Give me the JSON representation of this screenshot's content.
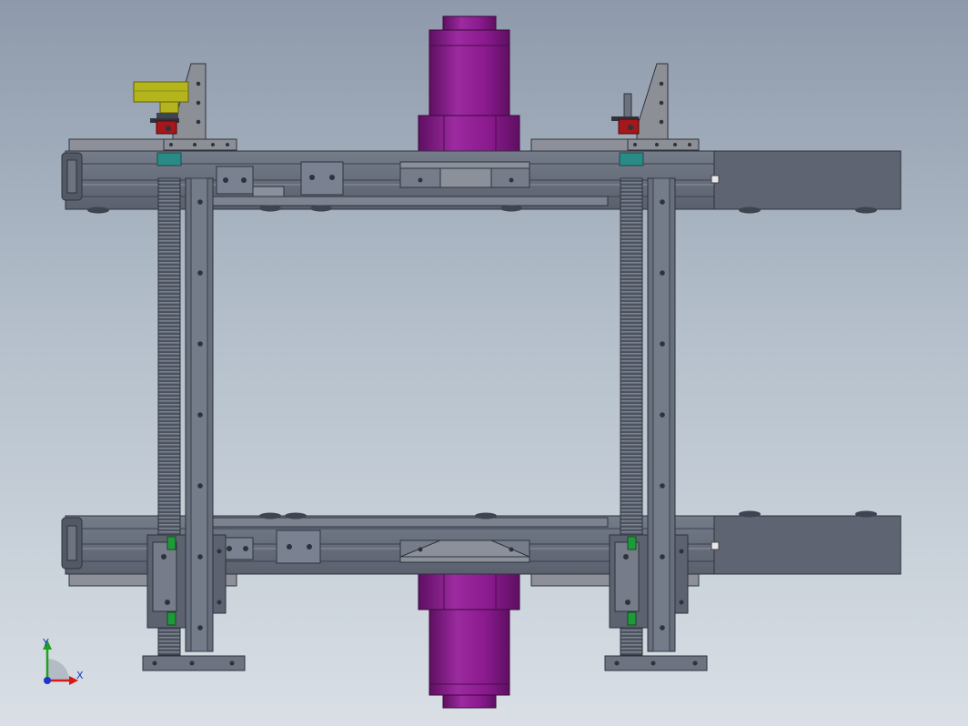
{
  "view": {
    "background_top": "#8e9aab",
    "background_bottom": "#d9dfe5"
  },
  "triad": {
    "x_label": "X",
    "y_label": "Y",
    "x_color": "#d21b1b",
    "y_color": "#1ea11e",
    "z_color": "#1b36c8"
  },
  "colors": {
    "frame": "#5f6674",
    "frame_light": "#7b8291",
    "frame_dark": "#3e4450",
    "rail_face": "#676e7c",
    "motor": "#8a1a8e",
    "motor_dark": "#5e0f62",
    "motor_light": "#a23aa6",
    "plate": "#8c8f96",
    "yellow": "#b4b41c",
    "red": "#a5171a",
    "green": "#1f9a3a",
    "teal": "#2a8a86"
  },
  "components": [
    "top-beam",
    "bottom-beam",
    "left-lead-screw",
    "right-lead-screw",
    "left-linear-rail",
    "right-linear-rail",
    "drive-motor-top",
    "drive-motor-bottom",
    "motor-mount-bracket-top",
    "motor-mount-bracket-bottom",
    "yellow-stepper-motor",
    "left-carriage-block",
    "right-carriage-block",
    "left-foot-plate",
    "right-foot-plate"
  ]
}
